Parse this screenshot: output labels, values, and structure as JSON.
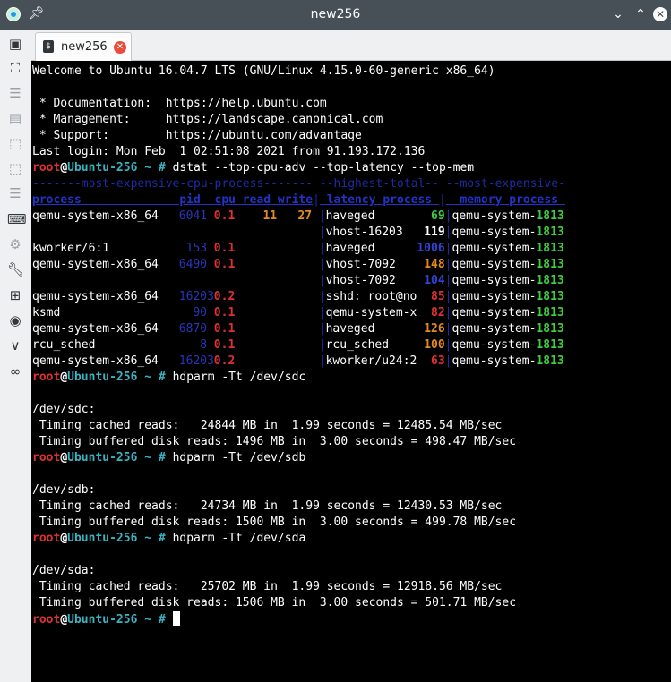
{
  "window": {
    "title": "new256",
    "pin_icon": "pin-icon",
    "controls": [
      "minimize-icon",
      "maximize-icon",
      "close-icon"
    ]
  },
  "tab": {
    "label": "new256"
  },
  "sidebar_icons": [
    "session-icon",
    "fullscreen-icon",
    "menu-icon",
    "new-window-icon",
    "split-icon",
    "split-view-icon",
    "list-icon",
    "keyboard-icon",
    "settings-icon",
    "tools-icon",
    "add-tab-icon",
    "camera-icon",
    "chevron-down-icon",
    "link-icon"
  ],
  "colors": {
    "titlebar": "#475057",
    "terminal_bg": "#000000",
    "prompt_user": "#e03030",
    "prompt_host": "#3bb3c3"
  },
  "terminal": {
    "welcome": "Welcome to Ubuntu 16.04.7 LTS (GNU/Linux 4.15.0-60-generic x86_64)",
    "doc": " * Documentation:  https://help.ubuntu.com",
    "mgmt": " * Management:     https://landscape.canonical.com",
    "support": " * Support:        https://ubuntu.com/advantage",
    "last_login": "Last login: Mon Feb  1 02:51:08 2021 from 91.193.172.136",
    "prompt": {
      "user": "root",
      "at": "@",
      "host": "Ubuntu-256",
      "sep": " ~ # "
    },
    "cmd_dstat": "dstat --top-cpu-adv --top-latency --top-mem",
    "dstat_header1": {
      "cpu": "-------most-expensive-cpu-process-------",
      "lat": "--highest-total--",
      "mem": "--most-expensive-"
    },
    "dstat_header2": {
      "cpu": "process              pid  cpu read write",
      "lat": " latency process ",
      "mem": "  memory process "
    },
    "dstat_rows": [
      {
        "proc": "qemu-system-x86_64   ",
        "pid": "6041 ",
        "cpu": "0.1 ",
        "read": "   11 ",
        "write": "  27 ",
        "lat_name": "haveged       ",
        "lat_val": " 69",
        "lat_color": "c-green-b",
        "mem_name": "qemu-system-",
        "mem_val": "1813"
      },
      {
        "proc": "",
        "pid": "",
        "cpu": "",
        "read": "",
        "write": "",
        "lat_name": "vhost-16203   ",
        "lat_val": "119",
        "lat_color": "c-white-b",
        "mem_name": "qemu-system-",
        "mem_val": "1813"
      },
      {
        "proc": "kworker/6:1          ",
        "pid": " 153 ",
        "cpu": "0.1 ",
        "read": "",
        "write": "",
        "lat_name": "haveged      ",
        "lat_val": "1006",
        "lat_color": "c-blue-b",
        "mem_name": "qemu-system-",
        "mem_val": "1813"
      },
      {
        "proc": "qemu-system-x86_64   ",
        "pid": "6490 ",
        "cpu": "0.1 ",
        "read": "",
        "write": "",
        "lat_name": "vhost-7092    ",
        "lat_val": "148",
        "lat_color": "c-orange-b",
        "mem_name": "qemu-system-",
        "mem_val": "1813"
      },
      {
        "proc": "",
        "pid": "",
        "cpu": "",
        "read": "",
        "write": "",
        "lat_name": "vhost-7092    ",
        "lat_val": "104",
        "lat_color": "c-blue-b",
        "mem_name": "qemu-system-",
        "mem_val": "1813"
      },
      {
        "proc": "qemu-system-x86_64   ",
        "pid": "16203",
        "cpu": "0.2 ",
        "read": "",
        "write": "",
        "lat_name": "sshd: root@no ",
        "lat_val": " 85",
        "lat_color": "c-red-b",
        "mem_name": "qemu-system-",
        "mem_val": "1813"
      },
      {
        "proc": "ksmd                 ",
        "pid": "  90 ",
        "cpu": "0.1 ",
        "read": "",
        "write": "",
        "lat_name": "qemu-system-x ",
        "lat_val": " 82",
        "lat_color": "c-red-b",
        "mem_name": "qemu-system-",
        "mem_val": "1813"
      },
      {
        "proc": "qemu-system-x86_64   ",
        "pid": "6870 ",
        "cpu": "0.1 ",
        "read": "",
        "write": "",
        "lat_name": "haveged       ",
        "lat_val": "126",
        "lat_color": "c-orange-b",
        "mem_name": "qemu-system-",
        "mem_val": "1813"
      },
      {
        "proc": "rcu_sched            ",
        "pid": "   8 ",
        "cpu": "0.1 ",
        "read": "",
        "write": "",
        "lat_name": "rcu_sched     ",
        "lat_val": "100",
        "lat_color": "c-orange-b",
        "mem_name": "qemu-system-",
        "mem_val": "1813"
      },
      {
        "proc": "qemu-system-x86_64   ",
        "pid": "16203",
        "cpu": "0.2 ",
        "read": "",
        "write": "",
        "lat_name": "kworker/u24:2 ",
        "lat_val": " 63",
        "lat_color": "c-red-b",
        "mem_name": "qemu-system-",
        "mem_val": "1813"
      }
    ],
    "cmd_sdc": "hdparm -Tt /dev/sdc",
    "sdc_dev": "/dev/sdc:",
    "sdc_cached": " Timing cached reads:   24844 MB in  1.99 seconds = 12485.54 MB/sec",
    "sdc_buffered": " Timing buffered disk reads: 1496 MB in  3.00 seconds = 498.47 MB/sec",
    "cmd_sdb": "hdparm -Tt /dev/sdb",
    "sdb_dev": "/dev/sdb:",
    "sdb_cached": " Timing cached reads:   24734 MB in  1.99 seconds = 12430.53 MB/sec",
    "sdb_buffered": " Timing buffered disk reads: 1500 MB in  3.00 seconds = 499.78 MB/sec",
    "cmd_sda": "hdparm -Tt /dev/sda",
    "sda_dev": "/dev/sda:",
    "sda_cached": " Timing cached reads:   25702 MB in  1.99 seconds = 12918.56 MB/sec",
    "sda_buffered": " Timing buffered disk reads: 1506 MB in  3.00 seconds = 501.71 MB/sec"
  }
}
